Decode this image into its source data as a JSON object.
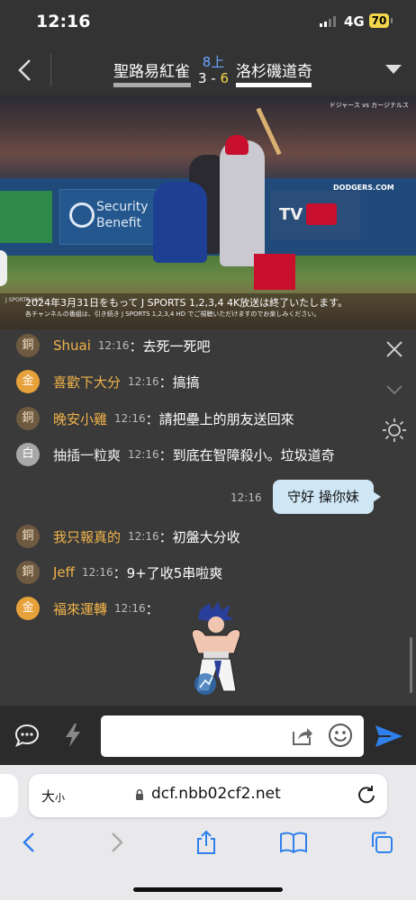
{
  "status": {
    "time": "12:16",
    "network": "4G",
    "battery": "70"
  },
  "header": {
    "home_team": "聖路易紅雀",
    "away_team": "洛杉磯道奇",
    "inning": "8上",
    "score_home": "3",
    "score_sep": " - ",
    "score_away": "6"
  },
  "video": {
    "brand": "ドジャース vs カージナルス",
    "ad_text": "Security\nBenefit",
    "ad2_text": "TV",
    "wall_text": "DODGERS.COM",
    "caption_main": "2024年3月31日をもって J SPORTS 1,2,3,4 4K放送は終了いたします。",
    "caption_sub": "各チャンネルの番組は、引き続き J SPORTS 1,2,3,4 HD でご視聴いただけますのでお楽しみください。",
    "network_logo": "J SPORTS LIVE"
  },
  "chat": {
    "messages": [
      {
        "badge": "銅",
        "level": "cu",
        "nick": "Shuai",
        "time": "12:16",
        "text": "：去死一死吧"
      },
      {
        "badge": "金",
        "level": "au",
        "nick": "喜歡下大分",
        "time": "12:16",
        "text": "：搞搞"
      },
      {
        "badge": "銅",
        "level": "cu",
        "nick": "晚安小雞",
        "time": "12:16",
        "text": "：請把壘上的朋友送回來"
      },
      {
        "badge": "白",
        "level": "ag",
        "nick": "抽插一粒爽",
        "time": "12:16",
        "text": "：到底在智障殺小。垃圾道奇"
      },
      {
        "badge": "銅",
        "level": "cu",
        "nick": "我只報真的",
        "time": "12:16",
        "text": "：初盤大分收"
      },
      {
        "badge": "銅",
        "level": "cu",
        "nick": "Jeff",
        "time": "12:16",
        "text": "：9+了收5串啦爽"
      },
      {
        "badge": "金",
        "level": "au",
        "nick": "福來運轉",
        "time": "12:16",
        "text": "："
      }
    ],
    "my_message": {
      "time": "12:16",
      "text": "守好  操你妹"
    }
  },
  "input": {
    "placeholder": ""
  },
  "browser": {
    "text_size": "大",
    "text_size_small": "小",
    "url": "dcf.nbb02cf2.net"
  },
  "colors": {
    "accent": "#2f80ed",
    "gold": "#f0b34a",
    "score_away": "#f2d64b",
    "inning": "#6aa7ff"
  }
}
